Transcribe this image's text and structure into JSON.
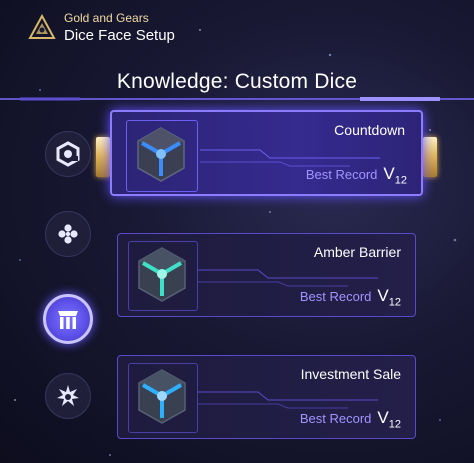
{
  "header": {
    "game_name": "Gold and Gears",
    "screen_title": "Dice Face Setup",
    "logo_icon": "gold-gears-emblem-icon"
  },
  "section": {
    "title": "Knowledge: Custom Dice"
  },
  "side_icons": [
    {
      "name": "swirl-hex-icon",
      "selected": false
    },
    {
      "name": "hexagon-cluster-icon",
      "selected": false
    },
    {
      "name": "gate-pillars-icon",
      "selected": true
    },
    {
      "name": "spiky-star-icon",
      "selected": false
    }
  ],
  "cards": [
    {
      "name": "Countdown",
      "record_label": "Best Record",
      "record_value": "V",
      "record_sub": "12",
      "active": true,
      "glow_color": "#3a8cff"
    },
    {
      "name": "Amber Barrier",
      "record_label": "Best Record",
      "record_value": "V",
      "record_sub": "12",
      "active": false,
      "glow_color": "#3fe0c8"
    },
    {
      "name": "Investment Sale",
      "record_label": "Best Record",
      "record_value": "V",
      "record_sub": "12",
      "active": false,
      "glow_color": "#2fb0ff"
    }
  ],
  "colors": {
    "accent": "#8d7cff",
    "gold": "#f1dca4",
    "record_label": "#a294ff"
  }
}
